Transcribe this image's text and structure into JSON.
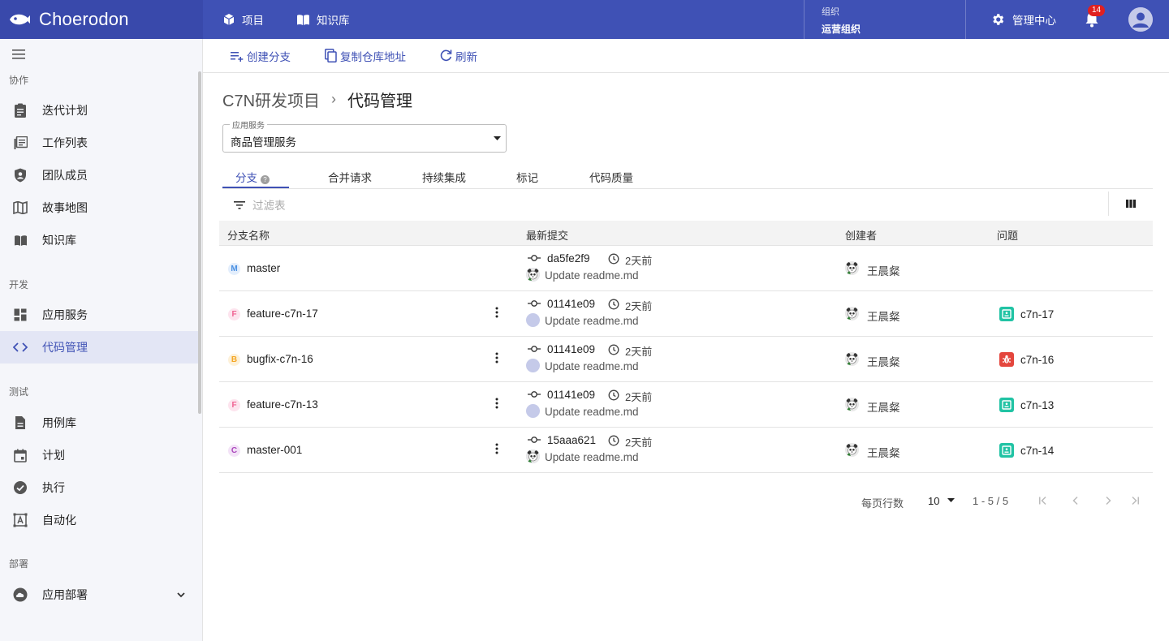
{
  "topbar": {
    "brand": "Choerodon",
    "nav": [
      {
        "label": "项目",
        "icon": "cube-icon"
      },
      {
        "label": "知识库",
        "icon": "book-icon"
      }
    ],
    "org_label": "组织",
    "org_name": "运营组织",
    "admin_label": "管理中心",
    "notification_count": "14",
    "colors": {
      "primary": "#3f51b5"
    }
  },
  "sidebar": {
    "groups": {
      "collab": "协作",
      "dev": "开发",
      "test": "测试",
      "deploy": "部署"
    },
    "items": [
      {
        "label": "迭代计划",
        "icon": "clipboard-icon"
      },
      {
        "label": "工作列表",
        "icon": "list-icon"
      },
      {
        "label": "团队成员",
        "icon": "shield-user-icon"
      },
      {
        "label": "故事地图",
        "icon": "map-icon"
      },
      {
        "label": "知识库",
        "icon": "book-icon"
      },
      {
        "label": "应用服务",
        "icon": "dashboard-icon"
      },
      {
        "label": "代码管理",
        "icon": "code-icon",
        "active": true
      },
      {
        "label": "用例库",
        "icon": "document-icon"
      },
      {
        "label": "计划",
        "icon": "calendar-icon"
      },
      {
        "label": "执行",
        "icon": "check-circle-icon"
      },
      {
        "label": "自动化",
        "icon": "automation-icon"
      },
      {
        "label": "应用部署",
        "icon": "cloud-icon"
      }
    ]
  },
  "toolbar": {
    "create_branch": "创建分支",
    "copy_repo": "复制仓库地址",
    "refresh": "刷新"
  },
  "breadcrumb": {
    "project": "C7N研发项目",
    "current": "代码管理"
  },
  "service_select": {
    "label": "应用服务",
    "value": "商品管理服务"
  },
  "tabs": [
    "分支",
    "合并请求",
    "持续集成",
    "标记",
    "代码质量"
  ],
  "filter": {
    "placeholder": "过滤表"
  },
  "table": {
    "headers": [
      "分支名称",
      "最新提交",
      "创建者",
      "问题"
    ],
    "rows": [
      {
        "badge": "M",
        "badge_color": "#4a90e2",
        "badge_bg": "#e3eefc",
        "name": "master",
        "sha": "da5fe2f9",
        "time": "2天前",
        "message": "Update readme.md",
        "author": "王晨粲",
        "issue": "",
        "issue_type": ""
      },
      {
        "badge": "F",
        "badge_color": "#f06292",
        "badge_bg": "#fde4ee",
        "name": "feature-c7n-17",
        "sha": "01141e09",
        "time": "2天前",
        "message": "Update readme.md",
        "author": "王晨粲",
        "issue": "c7n-17",
        "issue_type": "story"
      },
      {
        "badge": "B",
        "badge_color": "#f5a623",
        "badge_bg": "#fdf1d9",
        "name": "bugfix-c7n-16",
        "sha": "01141e09",
        "time": "2天前",
        "message": "Update readme.md",
        "author": "王晨粲",
        "issue": "c7n-16",
        "issue_type": "bug"
      },
      {
        "badge": "F",
        "badge_color": "#f06292",
        "badge_bg": "#fde4ee",
        "name": "feature-c7n-13",
        "sha": "01141e09",
        "time": "2天前",
        "message": "Update readme.md",
        "author": "王晨粲",
        "issue": "c7n-13",
        "issue_type": "story"
      },
      {
        "badge": "C",
        "badge_color": "#ab47bc",
        "badge_bg": "#f3e3f7",
        "name": "master-001",
        "sha": "15aaa621",
        "time": "2天前",
        "message": "Update readme.md",
        "author": "王晨粲",
        "issue": "c7n-14",
        "issue_type": "story"
      }
    ]
  },
  "pagination": {
    "rows_per_page_label": "每页行数",
    "page_size": "10",
    "range": "1 - 5 / 5"
  }
}
